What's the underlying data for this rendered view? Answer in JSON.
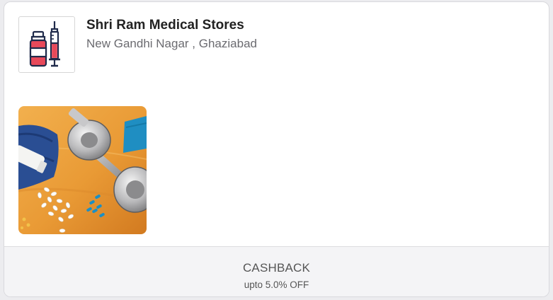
{
  "store": {
    "name": "Shri Ram Medical Stores",
    "location": "New Gandhi Nagar , Ghaziabad",
    "logo_icon": "medicine-bottle-syringe-icon",
    "photo": "fitness-supplements-dumbbell-photo"
  },
  "offer": {
    "title": "CASHBACK",
    "detail": "upto 5.0% OFF"
  },
  "colors": {
    "background": "#ececef",
    "card": "#ffffff",
    "footer": "#f4f4f6",
    "logo_red": "#e8495a",
    "logo_navy": "#1f2a4a"
  }
}
